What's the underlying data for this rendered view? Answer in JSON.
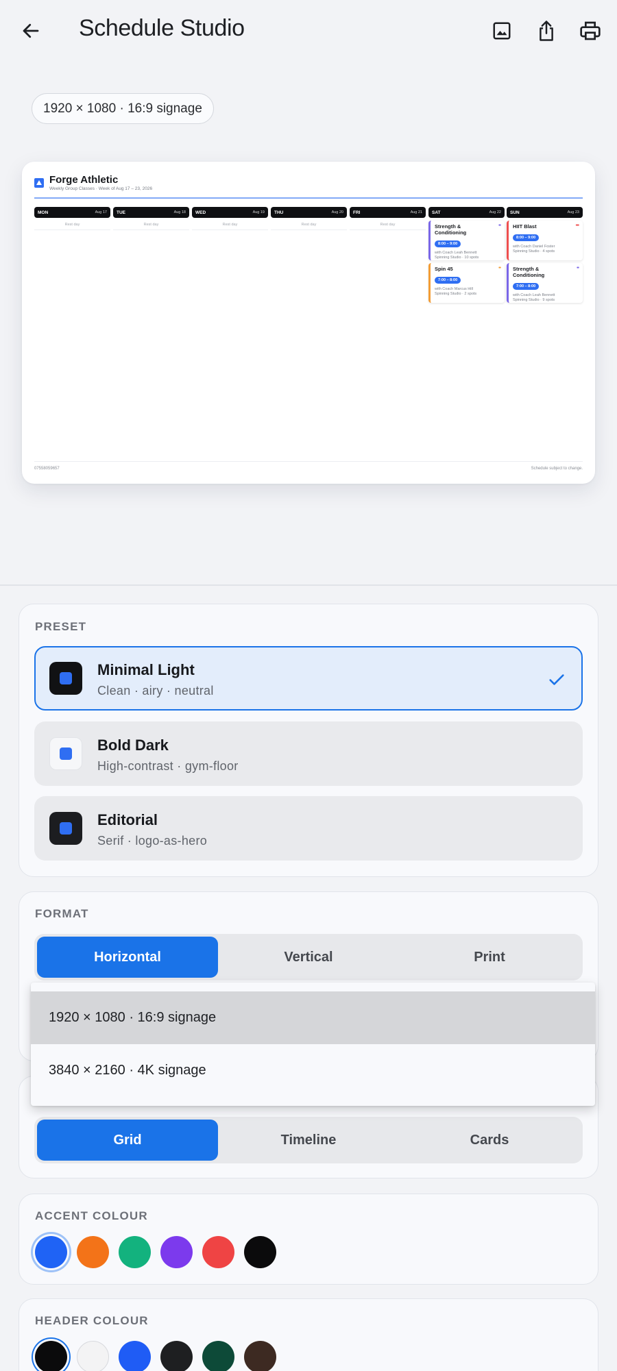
{
  "app": {
    "title": "Schedule Studio"
  },
  "toolbar": {
    "back": "back-arrow-icon",
    "image": "image-icon",
    "share": "share-icon",
    "print": "print-icon"
  },
  "size_chip": "1920 × 1080 · 16:9 signage",
  "preview": {
    "brand": "Forge Athletic",
    "subtitle": "Weekly Group Classes  ·  Week of Aug 17 – 23, 2026",
    "days": [
      {
        "name": "MON",
        "date": "Aug 17",
        "rest": "Rest day"
      },
      {
        "name": "TUE",
        "date": "Aug 18",
        "rest": "Rest day"
      },
      {
        "name": "WED",
        "date": "Aug 19",
        "rest": "Rest day"
      },
      {
        "name": "THU",
        "date": "Aug 20",
        "rest": "Rest day"
      },
      {
        "name": "FRI",
        "date": "Aug 21",
        "rest": "Rest day"
      },
      {
        "name": "SAT",
        "date": "Aug 22"
      },
      {
        "name": "SUN",
        "date": "Aug 23"
      }
    ],
    "classes": {
      "sat": [
        {
          "name": "Strength & Conditioning",
          "time": "8:00 – 9:00",
          "coach": "with Coach Leah Bennett",
          "location": "Spinning Studio  ·  10 spots",
          "color": "#7a67e8",
          "dots": "••"
        },
        {
          "name": "Spin 45",
          "time": "7:00 – 8:00",
          "coach": "with Coach Marcus Hill",
          "location": "Spinning Studio  ·  2 spots",
          "color": "#f39c34",
          "dots": "••"
        }
      ],
      "sun": [
        {
          "name": "HIIT Blast",
          "time": "8:00 – 9:00",
          "coach": "with Coach Daniel Foster",
          "location": "Spinning Studio  ·  4 spots",
          "color": "#ef4f4f",
          "dots": "•••"
        },
        {
          "name": "Strength & Conditioning",
          "time": "7:00 – 8:00",
          "coach": "with Coach Leah Bennett",
          "location": "Spinning Studio  ·  9 spots",
          "color": "#7a67e8",
          "dots": "••"
        }
      ]
    },
    "footer_left": "07558059657",
    "footer_right": "Schedule subject to change."
  },
  "preset": {
    "label": "PRESET",
    "items": [
      {
        "name": "Minimal Light",
        "desc": "Clean · airy · neutral",
        "selected": true,
        "swatch_bg": "#111214"
      },
      {
        "name": "Bold Dark",
        "desc": "High-contrast · gym-floor",
        "selected": false,
        "swatch_bg": "#f6f7f9"
      },
      {
        "name": "Editorial",
        "desc": "Serif · logo-as-hero",
        "selected": false,
        "swatch_bg": "#1c1d20"
      }
    ],
    "check_icon": "check-icon"
  },
  "format": {
    "label": "FORMAT",
    "options": [
      "Horizontal",
      "Vertical",
      "Print"
    ],
    "active": "Horizontal"
  },
  "size_dropdown": {
    "options": [
      "1920 × 1080 · 16:9 signage",
      "3840 × 2160 · 4K signage"
    ],
    "highlighted": "1920 × 1080 · 16:9 signage"
  },
  "layout": {
    "options": [
      "Grid",
      "Timeline",
      "Cards"
    ],
    "active": "Grid"
  },
  "accent": {
    "label": "ACCENT COLOUR",
    "colors": [
      "#1f63f5",
      "#f37318",
      "#13b27e",
      "#7c3aed",
      "#ef4444",
      "#0b0b0c"
    ],
    "selected": "#1f63f5"
  },
  "header_colour": {
    "label": "HEADER COLOUR",
    "colors": [
      "#0b0b0c",
      "#f3f3f4",
      "#1f5cf5",
      "#1e1f21",
      "#0d4a38",
      "#3d2a22"
    ],
    "selected": "#0b0b0c"
  }
}
